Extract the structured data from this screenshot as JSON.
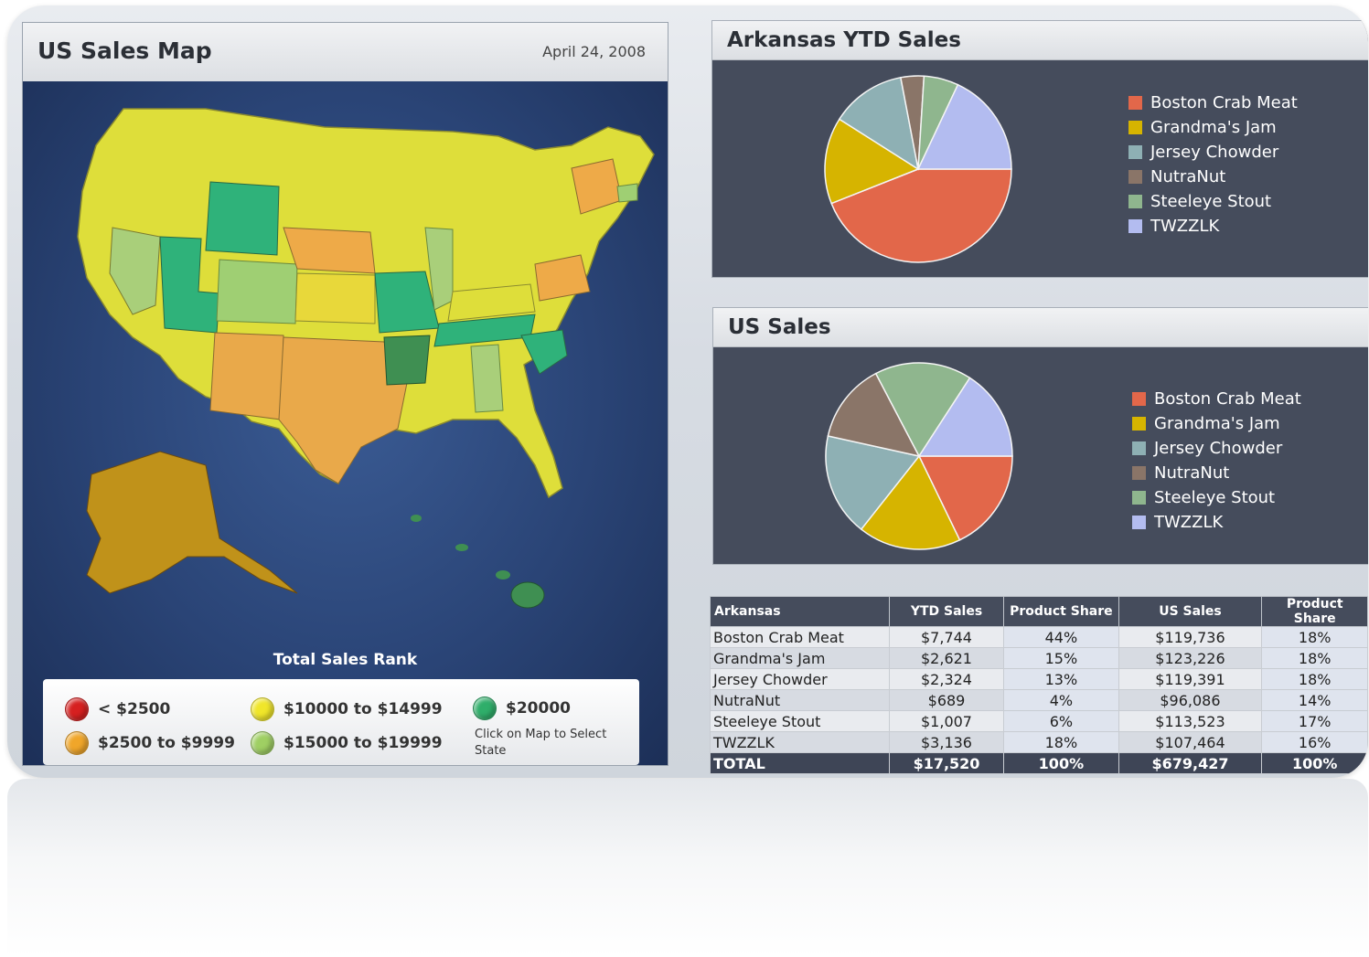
{
  "map_panel": {
    "title": "US Sales Map",
    "date": "April 24, 2008",
    "rank_title": "Total Sales Rank",
    "legend": [
      {
        "label": "< $2500",
        "color": "#d62020"
      },
      {
        "label": "$10000 to $14999",
        "color": "#f0e62a"
      },
      {
        "label": "$20000",
        "color": "#2fae6a"
      },
      {
        "label": "$2500 to $9999",
        "color": "#f0a62a"
      },
      {
        "label": "$15000 to $19999",
        "color": "#9fcf63"
      }
    ],
    "hint": "Click on Map to Select State"
  },
  "arkansas_chart": {
    "title": "Arkansas YTD Sales",
    "chart_data": {
      "type": "pie",
      "labels": [
        "Boston Crab Meat",
        "Grandma's Jam",
        "Jersey Chowder",
        "NutraNut",
        "Steeleye Stout",
        "TWZZLK"
      ],
      "values": [
        44,
        15,
        13,
        4,
        6,
        18
      ],
      "colors": [
        "#e2674a",
        "#d6b400",
        "#8eb0b4",
        "#8a7568",
        "#8fb68e",
        "#b3bcf0"
      ]
    }
  },
  "us_chart": {
    "title": "US Sales",
    "chart_data": {
      "type": "pie",
      "labels": [
        "Boston Crab Meat",
        "Grandma's Jam",
        "Jersey Chowder",
        "NutraNut",
        "Steeleye Stout",
        "TWZZLK"
      ],
      "values": [
        18,
        18,
        18,
        14,
        17,
        16
      ],
      "colors": [
        "#e2674a",
        "#d6b400",
        "#8eb0b4",
        "#8a7568",
        "#8fb68e",
        "#b3bcf0"
      ]
    }
  },
  "table": {
    "headers": [
      "Arkansas",
      "YTD Sales",
      "Product Share",
      "US Sales",
      "Product Share"
    ],
    "rows": [
      [
        "Boston Crab Meat",
        "$7,744",
        "44%",
        "$119,736",
        "18%"
      ],
      [
        "Grandma's Jam",
        "$2,621",
        "15%",
        "$123,226",
        "18%"
      ],
      [
        "Jersey Chowder",
        "$2,324",
        "13%",
        "$119,391",
        "18%"
      ],
      [
        "NutraNut",
        "$689",
        "4%",
        "$96,086",
        "14%"
      ],
      [
        "Steeleye Stout",
        "$1,007",
        "6%",
        "$113,523",
        "17%"
      ],
      [
        "TWZZLK",
        "$3,136",
        "18%",
        "$107,464",
        "16%"
      ]
    ],
    "total": [
      "TOTAL",
      "$17,520",
      "100%",
      "$679,427",
      "100%"
    ]
  }
}
